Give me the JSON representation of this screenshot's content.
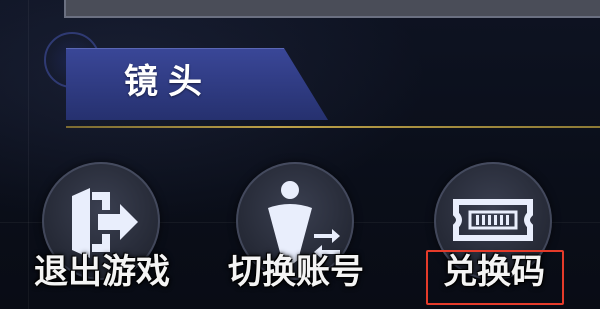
{
  "section": {
    "title": "镜头"
  },
  "actions": [
    {
      "id": "exit-game",
      "label": "退出游戏",
      "icon": "exit-door-icon"
    },
    {
      "id": "switch-account",
      "label": "切换账号",
      "icon": "switch-account-icon"
    },
    {
      "id": "redeem-code",
      "label": "兑换码",
      "icon": "ticket-icon"
    }
  ],
  "colors": {
    "tab_fill": "#303d85",
    "divider": "#bca048",
    "highlight": "#e53b2a",
    "icon": "#e9eefc"
  }
}
